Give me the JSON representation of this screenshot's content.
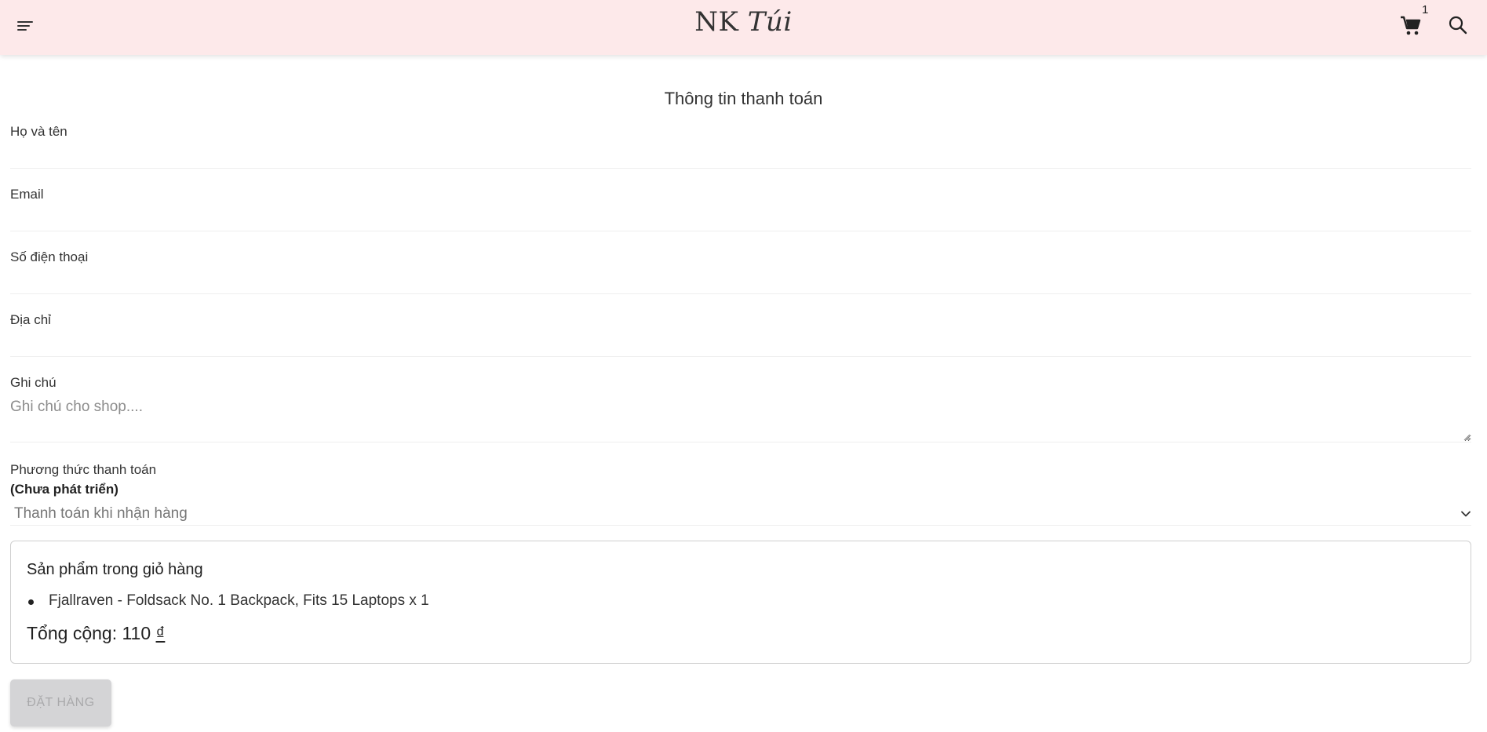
{
  "header": {
    "logo_prefix": "NK",
    "logo_name": "Túi",
    "cart_count": "1",
    "icons": [
      "menu-icon",
      "cart-icon",
      "search-icon"
    ],
    "background": "#fde9ea"
  },
  "form": {
    "title": "Thông tin thanh toán",
    "fields": [
      {
        "label": "Họ và tên",
        "value": ""
      },
      {
        "label": "Email",
        "value": ""
      },
      {
        "label": "Số điện thoại",
        "value": ""
      },
      {
        "label": "Địa chỉ",
        "value": ""
      }
    ],
    "note": {
      "label": "Ghi chú",
      "placeholder": "Ghi chú cho shop...."
    },
    "payment": {
      "label": "Phương thức thanh toán",
      "sublabel": "(Chưa phát triển)",
      "selected": "Thanh toán khi nhận hàng"
    }
  },
  "cart": {
    "title": "Sản phẩm trong giỏ hàng",
    "items": [
      {
        "text": "Fjallraven - Foldsack No. 1 Backpack, Fits 15 Laptops x 1"
      }
    ],
    "total_label": "Tổng cộng: 110",
    "currency": "₫"
  },
  "actions": {
    "order_button": "ĐẶT HÀNG"
  }
}
